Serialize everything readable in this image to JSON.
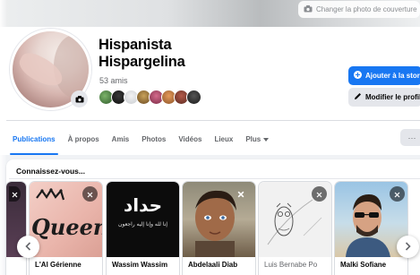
{
  "cover": {
    "button_label": "Changer la photo de couverture",
    "icon": "camera-icon"
  },
  "profile": {
    "name_line1": "Hispanista",
    "name_line2": "Hispargelina",
    "friends_count": "53 amis",
    "avatar_camera_icon": "camera-icon"
  },
  "actions": {
    "add_story": "Ajouter à la story",
    "edit_profile": "Modifier le profil",
    "add_icon": "plus-circle-icon",
    "edit_icon": "pencil-icon"
  },
  "tabs": [
    {
      "label": "Publications",
      "active": true
    },
    {
      "label": "À propos",
      "active": false
    },
    {
      "label": "Amis",
      "active": false
    },
    {
      "label": "Photos",
      "active": false
    },
    {
      "label": "Vidéos",
      "active": false
    },
    {
      "label": "Lieux",
      "active": false
    },
    {
      "label": "Plus",
      "active": false
    }
  ],
  "more_button": "···",
  "people_you_may_know": {
    "title": "Connaissez-vous...",
    "people": [
      {
        "name": "L'Al Gérienne"
      },
      {
        "name": "Wassim Wassim"
      },
      {
        "name": "Abdelaali Diab"
      },
      {
        "name": "Luis Bernabe Po"
      },
      {
        "name": "Malki Sofiane"
      }
    ],
    "card_texts": {
      "queen_text": "Queen",
      "arabic_title": "حداد",
      "arabic_sub": "إنا لله وإنا إليه راجعون"
    }
  },
  "colors": {
    "accent": "#1877f2",
    "secondary_button": "#e4e6eb",
    "muted_text": "#65676b",
    "page_bg": "#f0f2f5"
  }
}
